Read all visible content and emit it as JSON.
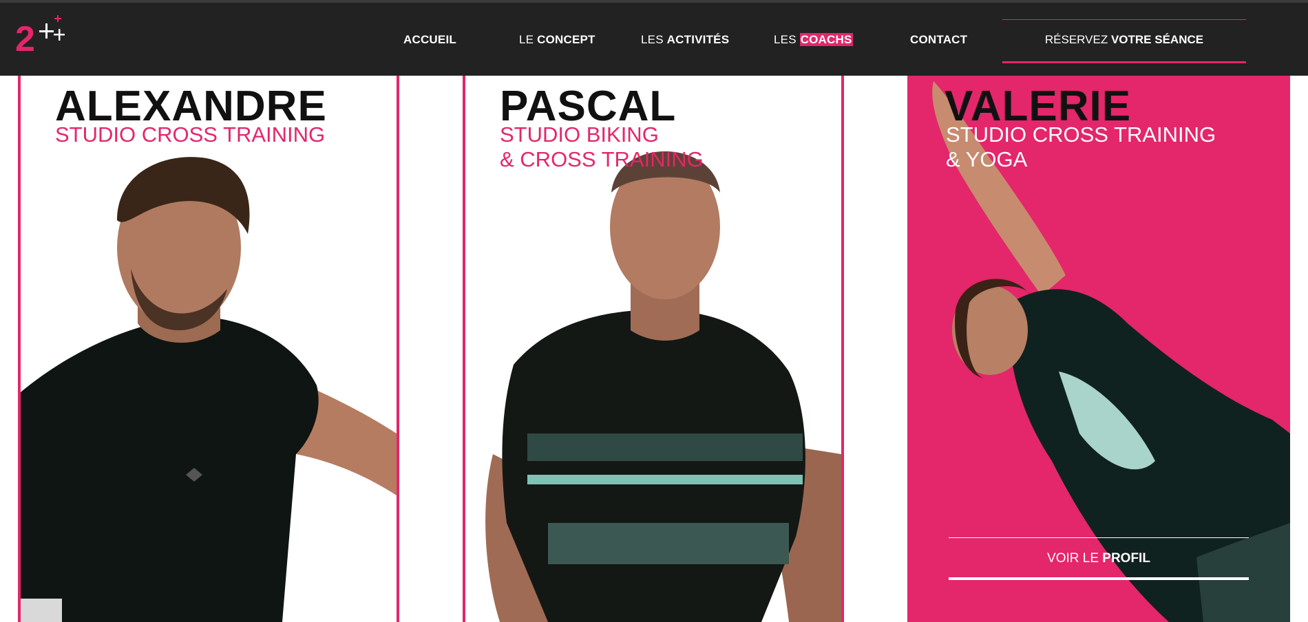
{
  "colors": {
    "accent": "#e4266a",
    "header_bg": "#222222",
    "text_dark": "#111111"
  },
  "logo": {
    "text": "2",
    "icon": "plus-plus-logo"
  },
  "nav": {
    "accueil": {
      "bold": "ACCUEIL"
    },
    "concept": {
      "light": "LE ",
      "bold": "CONCEPT"
    },
    "activites": {
      "light": "LES ",
      "bold": "ACTIVITÉS"
    },
    "coachs": {
      "light": "LES ",
      "bold": "COACHS"
    },
    "contact": {
      "bold": "CONTACT"
    },
    "cta": {
      "light": "RÉSERVEZ ",
      "bold": "VOTRE SÉANCE"
    }
  },
  "coaches": [
    {
      "name": "ALEXANDRE",
      "line1": "STUDIO CROSS TRAINING",
      "line2": ""
    },
    {
      "name": "PASCAL",
      "line1": "STUDIO BIKING",
      "line2": "& CROSS TRAINING"
    },
    {
      "name": "VALERIE",
      "line1": "STUDIO CROSS TRAINING",
      "line2": "& YOGA"
    }
  ],
  "profile_button": {
    "light": "VOIR LE ",
    "bold": "PROFIL"
  }
}
